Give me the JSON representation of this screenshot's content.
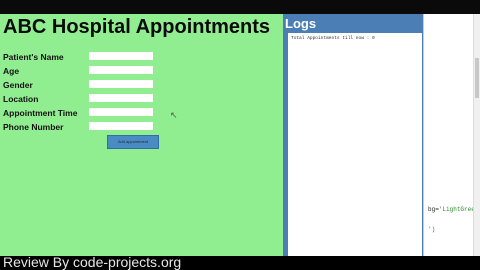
{
  "form": {
    "title": "ABC Hospital Appointments",
    "fields": [
      {
        "label": "Patient's Name",
        "value": ""
      },
      {
        "label": "Age",
        "value": ""
      },
      {
        "label": "Gender",
        "value": ""
      },
      {
        "label": "Location",
        "value": ""
      },
      {
        "label": "Appointment Time",
        "value": ""
      },
      {
        "label": "Phone Number",
        "value": ""
      }
    ],
    "add_button_label": "Add appointment"
  },
  "logs": {
    "title": "Logs",
    "text": "Total Appointments till now : 0"
  },
  "editor": {
    "line1_prefix": "bg=",
    "line1_string": "'LightGree",
    "line2": "')"
  },
  "watermark": "Review By code-projects.org",
  "colors": {
    "form_bg": "#90ee90",
    "logs_header": "#4a7eb5",
    "button": "#4a8bc4"
  }
}
